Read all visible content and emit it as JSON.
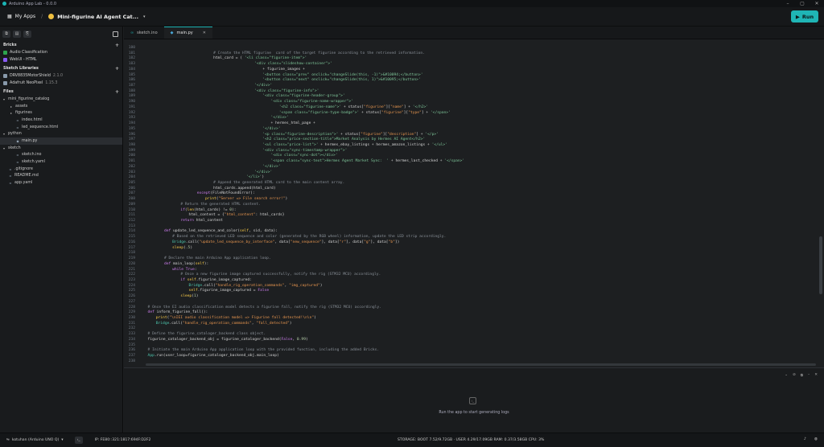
{
  "titlebar": {
    "title": "Arduino App Lab - 0.0.0"
  },
  "appbar": {
    "apps_label": "My Apps",
    "separator": "/",
    "project_name": "Mini-figurine AI Agent Cat...",
    "run_label": "Run"
  },
  "sidebar": {
    "bricks_header": "Bricks",
    "bricks": [
      {
        "label": "Audio Classification",
        "color": "#2da44e"
      },
      {
        "label": "WebUI - HTML",
        "color": "#8b5cf6"
      }
    ],
    "libraries_header": "Sketch Libraries",
    "libraries": [
      {
        "label": "DRV8835MotorShield",
        "version": "2.1.0"
      },
      {
        "label": "Adafruit NeoPixel",
        "version": "1.15.3"
      }
    ],
    "files_header": "Files",
    "files": [
      {
        "label": "mini_figurine_catalog",
        "indent": 0,
        "type": "folder-open"
      },
      {
        "label": "assets",
        "indent": 1,
        "type": "folder"
      },
      {
        "label": "figurines",
        "indent": 1,
        "type": "folder"
      },
      {
        "label": "index.html",
        "indent": 1,
        "type": "file"
      },
      {
        "label": "led_sequence.html",
        "indent": 1,
        "type": "file"
      },
      {
        "label": "python",
        "indent": 0,
        "type": "folder-open"
      },
      {
        "label": "main.py",
        "indent": 1,
        "type": "py",
        "selected": true
      },
      {
        "label": "sketch",
        "indent": 0,
        "type": "folder-open"
      },
      {
        "label": "sketch.ino",
        "indent": 1,
        "type": "file"
      },
      {
        "label": "sketch.yaml",
        "indent": 1,
        "type": "file"
      },
      {
        "label": ".gitignore",
        "indent": 0,
        "type": "file"
      },
      {
        "label": "README.md",
        "indent": 0,
        "type": "file"
      },
      {
        "label": "app.yaml",
        "indent": 0,
        "type": "file"
      }
    ]
  },
  "tabs": [
    {
      "label": "sketch.ino",
      "active": false
    },
    {
      "label": "main.py",
      "active": true
    }
  ],
  "code_lines": [
    {
      "n": "180",
      "i": 0,
      "t": ""
    },
    {
      "n": "181",
      "i": 33,
      "t": "# Create the HTML figurine  card of the target figurine according to the retrieved information."
    },
    {
      "n": "182",
      "i": 33,
      "t": "html_card = ( '<li class=\"figurine-item\">'"
    },
    {
      "n": "183",
      "i": 53,
      "t": "'<div class=\"slideshow-container\">'"
    },
    {
      "n": "184",
      "i": 57,
      "t": "+ figurine_images +"
    },
    {
      "n": "185",
      "i": 57,
      "t": "'<button class=\"prev\" onclick=\"changeSlide(this, -1)\">&#10094;</button>'"
    },
    {
      "n": "186",
      "i": 57,
      "t": "'<button class=\"next\" onclick=\"changeSlide(this, 1)\">&#10095;</button>'"
    },
    {
      "n": "187",
      "i": 53,
      "t": "'</div>'"
    },
    {
      "n": "188",
      "i": 53,
      "t": "'<div class=\"figurine-info\">'"
    },
    {
      "n": "189",
      "i": 57,
      "t": "'<div class=\"figurine-header-group\">'"
    },
    {
      "n": "190",
      "i": 61,
      "t": "'<div class=\"figurine-name-wrapper\">'"
    },
    {
      "n": "191",
      "i": 65,
      "t": "'<h2 class=\"figurine-name\">' + status[\"figurine\"][\"name\"] + '</h2>'"
    },
    {
      "n": "192",
      "i": 65,
      "t": "'<span class=\"figurine-type-badge\">' + status[\"figurine\"][\"type\"] + '</span>'"
    },
    {
      "n": "193",
      "i": 61,
      "t": "'</div>'"
    },
    {
      "n": "194",
      "i": 61,
      "t": "+ hermes_html_page +"
    },
    {
      "n": "195",
      "i": 57,
      "t": "'</div>'"
    },
    {
      "n": "196",
      "i": 57,
      "t": "'<p class=\"figurine-description\">' + status[\"figurine\"][\"description\"] + '</p>'"
    },
    {
      "n": "197",
      "i": 57,
      "t": "'<h2 class=\"price-section-title\">Market Analysis by Hermes AI Agent</h2>'"
    },
    {
      "n": "198",
      "i": 57,
      "t": "'<ul class=\"price-list\">' + hermes_ebay_listings + hermes_amazon_listings + '</ul>'"
    },
    {
      "n": "199",
      "i": 57,
      "t": "'<div class=\"sync-timestamp-wrapper\">'"
    },
    {
      "n": "200",
      "i": 61,
      "t": "'<div class=\"sync-dot\"></div>'"
    },
    {
      "n": "201",
      "i": 61,
      "t": "'<span class=\"sync-text\">Hermes Agent Market Sync:  ' + hermes_last_checked + '</span>'"
    },
    {
      "n": "202",
      "i": 57,
      "t": "'</div>'"
    },
    {
      "n": "203",
      "i": 53,
      "t": "'</div>'"
    },
    {
      "n": "204",
      "i": 49,
      "t": "'</li>')"
    },
    {
      "n": "205",
      "i": 33,
      "t": "# Append the generated HTML card to the main content array."
    },
    {
      "n": "206",
      "i": 33,
      "t": "html_cards.append(html_card)"
    },
    {
      "n": "207",
      "i": 25,
      "t": "except(FileNotFoundError):"
    },
    {
      "n": "208",
      "i": 29,
      "t": "print(\"Server => File search error!\")"
    },
    {
      "n": "209",
      "i": 17,
      "t": "# Return the generated HTML content."
    },
    {
      "n": "210",
      "i": 17,
      "t": "if(len(html_cards) != 0):"
    },
    {
      "n": "211",
      "i": 21,
      "t": "html_content = {\"html_content\": html_cards}"
    },
    {
      "n": "212",
      "i": 17,
      "t": "return html_content"
    },
    {
      "n": "213",
      "i": 0,
      "t": ""
    },
    {
      "n": "214",
      "i": 9,
      "t": "def update_led_sequence_and_color(self, sid, data):"
    },
    {
      "n": "215",
      "i": 13,
      "t": "# Based on the retrieved LED sequence and color (generated by the RGB wheel) information, update the LED strip accordingly."
    },
    {
      "n": "216",
      "i": 13,
      "t": "Bridge.call(\"update_led_sequence_by_interface\", data[\"new_sequence\"], data[\"r\"], data[\"g\"], data[\"b\"])"
    },
    {
      "n": "217",
      "i": 13,
      "t": "sleep(.5)"
    },
    {
      "n": "218",
      "i": 0,
      "t": ""
    },
    {
      "n": "219",
      "i": 9,
      "t": "# Declare the main Arduino App application loop."
    },
    {
      "n": "220",
      "i": 9,
      "t": "def main_loop(self):"
    },
    {
      "n": "221",
      "i": 13,
      "t": "while True:"
    },
    {
      "n": "222",
      "i": 17,
      "t": "# Once a new figurine image captured successfully, notify the rig (STM32 MCU) accordingly."
    },
    {
      "n": "223",
      "i": 17,
      "t": "if self.figurine_image_captured:"
    },
    {
      "n": "224",
      "i": 21,
      "t": "Bridge.call(\"handle_rig_operation_commands\", \"img_captured\")"
    },
    {
      "n": "225",
      "i": 21,
      "t": "self.figurine_image_captured = False"
    },
    {
      "n": "226",
      "i": 17,
      "t": "sleep(1)"
    },
    {
      "n": "227",
      "i": 0,
      "t": ""
    },
    {
      "n": "228",
      "i": 1,
      "t": "# Once the EI audio classification model detects a figurine fall, notify the rig (STM32 MCU) accordingly."
    },
    {
      "n": "229",
      "i": 1,
      "t": "def inform_figurine_fall():"
    },
    {
      "n": "230",
      "i": 5,
      "t": "print(\"\\nIEI audio classification model => Figurine fall detected!\\n\\n\")"
    },
    {
      "n": "231",
      "i": 5,
      "t": "Bridge.call(\"handle_rig_operation_commands\", \"fall_detected\")"
    },
    {
      "n": "232",
      "i": 0,
      "t": ""
    },
    {
      "n": "233",
      "i": 1,
      "t": "# Define the figurine_cataloger_backend class object."
    },
    {
      "n": "234",
      "i": 1,
      "t": "figurine_cataloger_backend_obj = figurine_cataloger_backend(False, 0.99)"
    },
    {
      "n": "235",
      "i": 0,
      "t": ""
    },
    {
      "n": "236",
      "i": 1,
      "t": "# Initiate the main Arduino App application loop with the provided function, including the added Bricks."
    },
    {
      "n": "237",
      "i": 1,
      "t": "App.run(user_loop=figurine_cataloger_backend_obj.main_loop)"
    },
    {
      "n": "238",
      "i": 0,
      "t": ""
    }
  ],
  "logs": {
    "empty_message": "Run the app to start generating logs"
  },
  "statusbar": {
    "board": "kotuhan (Arduino UNO Q)",
    "ip": "IP: FE80::321:1817:694F:D2F2",
    "storage": "STORAGE: BOOT 7.52/9.72GB · USER 4.29/17.09GB   RAM: 0.37/3.58GB   CPU: 3%"
  },
  "colors": {
    "accent": "#1fb5b5",
    "background": "#1d1f21"
  }
}
